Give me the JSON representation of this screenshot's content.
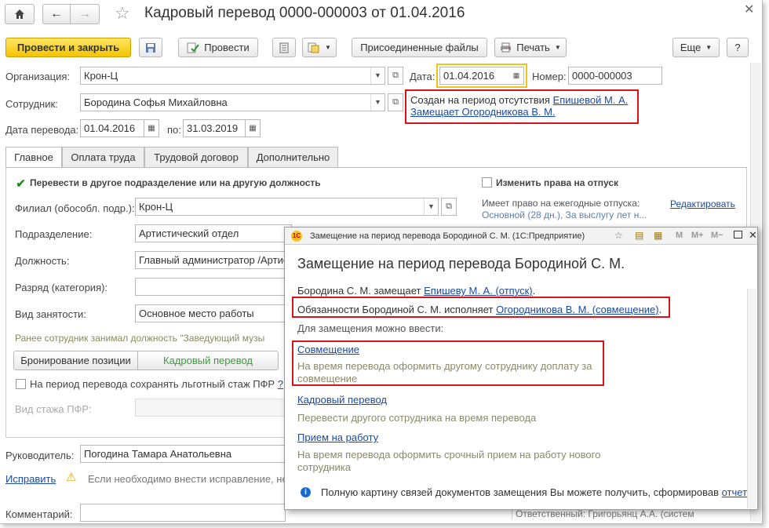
{
  "window": {
    "title": "Кадровый перевод 0000-000003 от 01.04.2016"
  },
  "toolbar": {
    "post_close": "Провести и закрыть",
    "post": "Провести",
    "attached": "Присоединенные файлы",
    "print": "Печать",
    "more": "Еще",
    "help": "?"
  },
  "header": {
    "org_label": "Организация:",
    "org_value": "Крон-Ц",
    "date_label": "Дата:",
    "date_value": "01.04.2016",
    "num_label": "Номер:",
    "num_value": "0000-000003",
    "emp_label": "Сотрудник:",
    "emp_value": "Бородина Софья Михайловна",
    "created_prefix": "Создан на период отсутствия",
    "created_link": "Епишевой М. А.",
    "replaces_link": "Замещает Огородникова В. М.",
    "transfer_date_label": "Дата перевода:",
    "transfer_date": "01.04.2016",
    "to_label": "по:",
    "to_date": "31.03.2019"
  },
  "tabs": [
    "Главное",
    "Оплата труда",
    "Трудовой договор",
    "Дополнительно"
  ],
  "main": {
    "transfer_check": "Перевести в другое подразделение или на другую должность",
    "branch_label": "Филиал (обособл. подр.):",
    "branch_value": "Крон-Ц",
    "dept_label": "Подразделение:",
    "dept_value": "Артистический отдел",
    "pos_label": "Должность:",
    "pos_value": "Главный администратор /Артис",
    "grade_label": "Разряд (категория):",
    "grade_value": "",
    "emp_type_label": "Вид занятости:",
    "emp_type_value": "Основное место работы",
    "prev_text": "Ранее сотрудник занимал должность \"Заведующий музы",
    "reserve_btn": "Бронирование позиции",
    "hr_transfer_btn": "Кадровый перевод",
    "pfr_check": "На период перевода сохранять льготный стаж ПФР",
    "pfr_q": "?",
    "pfr_type_label": "Вид стажа ПФР:",
    "change_rights": "Изменить права на отпуск",
    "annual_label": "Имеет право на ежегодные отпуска:",
    "edit_link": "Редактировать",
    "annual_value": "Основной (28 дн.), За выслугу лет н..."
  },
  "footer": {
    "head_label": "Руководитель:",
    "head_value": "Погодина Тамара Анатольевна",
    "fix_link": "Исправить",
    "fix_text": "Если необходимо внести исправление, не",
    "comment_label": "Комментарий:",
    "responsible": "Ответственный: Григорьянц А.А. (систем"
  },
  "popup": {
    "title": "Замещение на период перевода Бородиной С. М.  (1С:Предприятие)",
    "heading": "Замещение на период перевода Бородиной С. М.",
    "line1_prefix": "Бородина С. М. замещает",
    "line1_link": "Епишеву М. А. (отпуск)",
    "line1_suffix": ".",
    "line2_prefix": "Обязанности Бородиной С. М. исполняет",
    "line2_link": "Огородникова В. М. (совмещение)",
    "line2_suffix": ".",
    "can_enter": "Для замещения можно ввести:",
    "opt1_link": "Совмещение",
    "opt1_desc": "На время перевода оформить другому сотруднику доплату за совмещение",
    "opt2_link": "Кадровый перевод",
    "opt2_desc": "Перевести другого сотрудника на время перевода",
    "opt3_link": "Прием на работу",
    "opt3_desc": "На время перевода оформить срочный прием на работу нового сотрудника",
    "info_text": "Полную картину связей документов замещения Вы можете получить, сформировав",
    "info_link": "отчет"
  },
  "colors": {
    "accent_yellow": "#f3c400",
    "link": "#1a4aa8",
    "highlight_red": "#d8141a",
    "green_text": "#3a9a3a"
  }
}
